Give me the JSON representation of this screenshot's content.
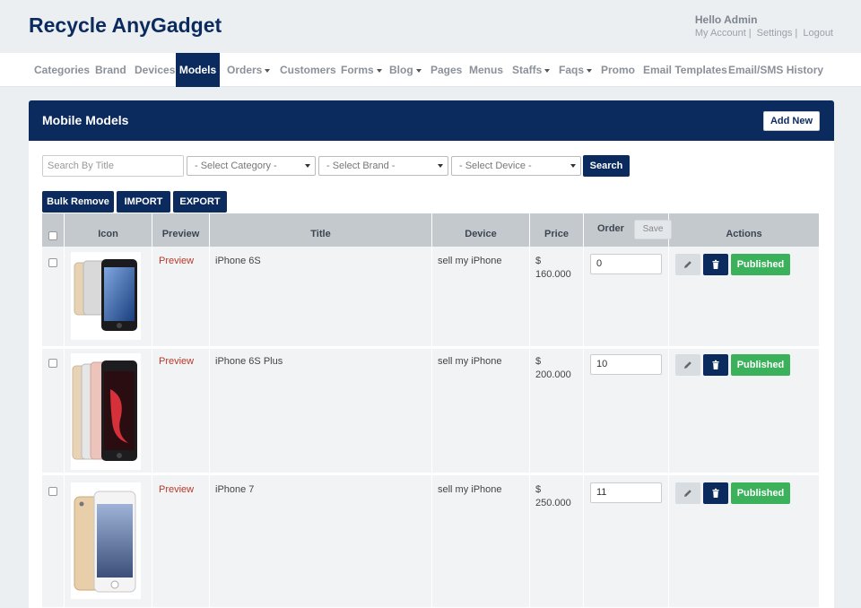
{
  "app": {
    "brand": "Recycle AnyGadget",
    "greeting": "Hello Admin",
    "links": {
      "account": "My Account",
      "settings": "Settings",
      "logout": "Logout"
    }
  },
  "nav": {
    "categories": "Categories",
    "brand": "Brand",
    "devices": "Devices",
    "models": "Models",
    "orders": "Orders",
    "customers": "Customers",
    "forms": "Forms",
    "blog": "Blog",
    "pages": "Pages",
    "menus": "Menus",
    "staffs": "Staffs",
    "faqs": "Faqs",
    "promo": "Promo",
    "email_templates": "Email Templates",
    "email_sms_history": "Email/SMS History"
  },
  "panel": {
    "title": "Mobile Models",
    "add_new": "Add New"
  },
  "filters": {
    "search_placeholder": "Search By Title",
    "category": "- Select Category -",
    "brand": "- Select Brand -",
    "device": "- Select Device -",
    "search_button": "Search"
  },
  "actions": {
    "bulk_remove": "Bulk Remove",
    "import": "IMPORT",
    "export": "EXPORT"
  },
  "table": {
    "headers": {
      "icon": "Icon",
      "preview": "Preview",
      "title": "Title",
      "device": "Device",
      "price": "Price",
      "order": "Order",
      "save": "Save",
      "actions": "Actions"
    },
    "rows": [
      {
        "preview": "Preview",
        "title": "iPhone 6S",
        "device": "sell my iPhone",
        "currency": "$",
        "price": "160.000",
        "order": "0",
        "status": "Published"
      },
      {
        "preview": "Preview",
        "title": "iPhone 6S Plus",
        "device": "sell my iPhone",
        "currency": "$",
        "price": "200.000",
        "order": "10",
        "status": "Published"
      },
      {
        "preview": "Preview",
        "title": "iPhone 7",
        "device": "sell my iPhone",
        "currency": "$",
        "price": "250.000",
        "order": "11",
        "status": "Published"
      }
    ]
  },
  "colors": {
    "primary": "#0b2a5e",
    "success": "#3cb15b",
    "link": "#b63a2a",
    "header_gray": "#c4c9ce"
  }
}
